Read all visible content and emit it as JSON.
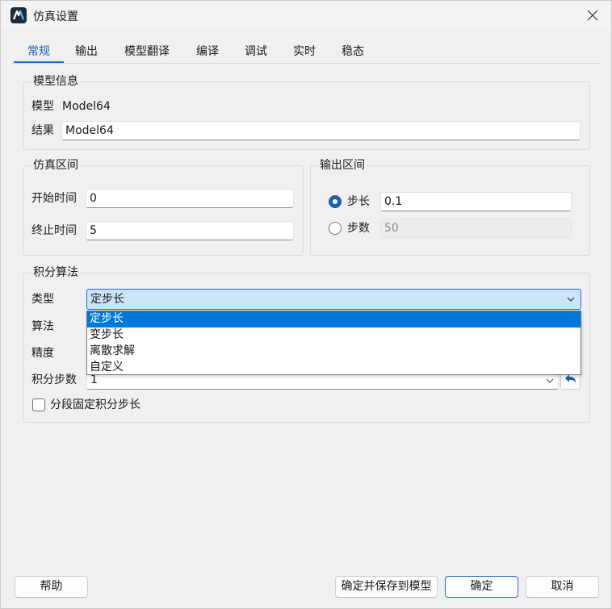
{
  "window": {
    "title": "仿真设置",
    "icon": "app-logo-icon",
    "close_icon": "close-icon"
  },
  "tabs": [
    {
      "label": "常规",
      "active": true
    },
    {
      "label": "输出"
    },
    {
      "label": "模型翻译"
    },
    {
      "label": "编译"
    },
    {
      "label": "调试"
    },
    {
      "label": "实时"
    },
    {
      "label": "稳态"
    }
  ],
  "model_info": {
    "title": "模型信息",
    "model_label": "模型",
    "model_value": "Model64",
    "result_label": "结果",
    "result_value": "Model64"
  },
  "sim_interval": {
    "title": "仿真区间",
    "start_label": "开始时间",
    "start_value": "0",
    "stop_label": "终止时间",
    "stop_value": "5"
  },
  "output_interval": {
    "title": "输出区间",
    "step_size_label": "步长",
    "step_size_value": "0.1",
    "step_count_label": "步数",
    "step_count_value": "50",
    "selected": "step_size"
  },
  "integration": {
    "title": "积分算法",
    "type_label": "类型",
    "type_value": "定步长",
    "type_options": [
      "定步长",
      "变步长",
      "离散求解",
      "自定义"
    ],
    "algorithm_label": "算法",
    "precision_label": "精度",
    "steps_label": "积分步数",
    "steps_value": "1",
    "segmented_label": "分段固定积分步长",
    "segmented_checked": false
  },
  "buttons": {
    "help": "帮助",
    "save_to_model": "确定并保存到模型",
    "ok": "确定",
    "cancel": "取消"
  },
  "colors": {
    "accent": "#1a5fb4",
    "selection": "#0078d7",
    "combo_bg": "#cce4f7"
  }
}
